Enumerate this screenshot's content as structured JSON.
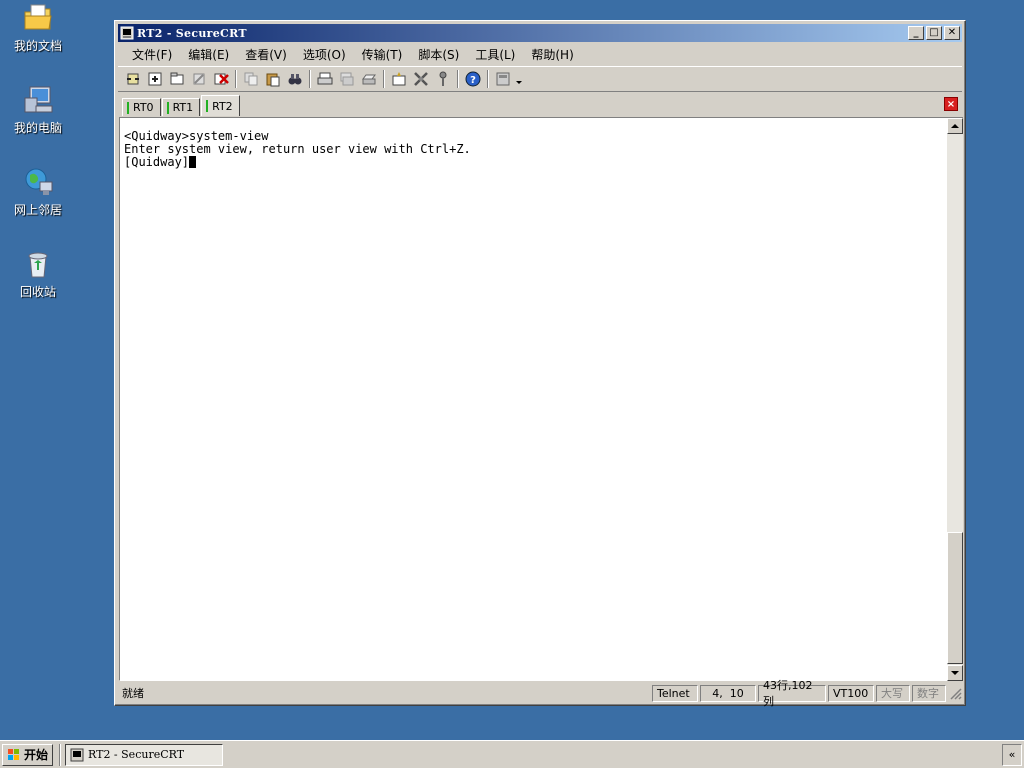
{
  "desktop": {
    "icons": [
      {
        "label": "我的文档",
        "icon": "folder-documents-icon"
      },
      {
        "label": "我的电脑",
        "icon": "computer-icon"
      },
      {
        "label": "网上邻居",
        "icon": "network-icon"
      },
      {
        "label": "回收站",
        "icon": "recycle-bin-icon"
      }
    ]
  },
  "window": {
    "title": "RT2 - SecureCRT",
    "minimize": "_",
    "maximize": "□",
    "close": "✕"
  },
  "menu": {
    "items": [
      "文件(F)",
      "编辑(E)",
      "查看(V)",
      "选项(O)",
      "传输(T)",
      "脚本(S)",
      "工具(L)",
      "帮助(H)"
    ]
  },
  "tabs": {
    "items": [
      "RT0",
      "RT1",
      "RT2"
    ],
    "active": "RT2",
    "close_label": "×"
  },
  "terminal": {
    "lines": [
      "<Quidway>system-view",
      "Enter system view, return user view with Ctrl+Z.",
      "[Quidway]"
    ]
  },
  "status": {
    "ready": "就绪",
    "protocol": "Telnet",
    "cursor_pos": "4,  10",
    "size": "43行,102列",
    "emulation": "VT100",
    "caps": "大写",
    "num": "数字"
  },
  "taskbar": {
    "start_label": "开始",
    "task_label": "RT2 - SecureCRT",
    "tray_label": "«"
  },
  "colors": {
    "desktop": "#3a6ea5",
    "titlebar_start": "#0a246a",
    "titlebar_end": "#a6caf0",
    "tab_marker": "#22b022",
    "tab_close": "#d82020"
  }
}
